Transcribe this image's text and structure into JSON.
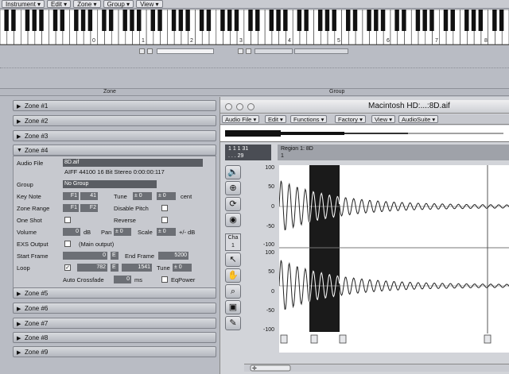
{
  "menubar": {
    "items": [
      "Instrument",
      "Edit",
      "Zone",
      "Group",
      "View"
    ]
  },
  "keyboard": {
    "octave_labels": [
      "0",
      "1",
      "2",
      "3",
      "4",
      "5",
      "6",
      "7",
      "8"
    ]
  },
  "dividers": {
    "zone_label": "Zone",
    "group_label": "Group"
  },
  "zones_top": [
    "Zone #1",
    "Zone #2",
    "Zone #3"
  ],
  "zone4": {
    "title": "Zone #4",
    "audio_file_label": "Audio File",
    "audio_file_name": "8D.aif",
    "file_info": "AIFF  44100  16 Bit  Stereo  0:00:00:117",
    "group_label": "Group",
    "group_value": "No Group",
    "key_note_label": "Key Note",
    "key_note": "F1",
    "key_note_num": "41",
    "tune_label": "Tune",
    "tune_a": "± 0",
    "tune_b": "± 0",
    "tune_unit": "cent",
    "zone_range_label": "Zone Range",
    "range_lo": "F1",
    "range_hi": "F2",
    "disable_pitch_label": "Disable Pitch",
    "one_shot_label": "One Shot",
    "reverse_label": "Reverse",
    "volume_label": "Volume",
    "volume_value": "0",
    "db_label": "dB",
    "pan_label": "Pan",
    "pan_value": "± 0",
    "scale_label": "Scale",
    "scale_value": "± 0",
    "scale_unit": "+/- dB",
    "exs_output_label": "EXS Output",
    "exs_output_value": "(Main output)",
    "start_frame_label": "Start Frame",
    "start_frame": "0",
    "e_label": "E",
    "end_frame_label": "End Frame",
    "end_frame": "5200",
    "loop_label": "Loop",
    "loop_start": "782",
    "loop_end": "1541",
    "loop_tune_label": "Tune",
    "loop_tune": "± 0",
    "auto_crossfade_label": "Auto Crossfade",
    "crossfade_value": "0",
    "ms_label": "ms",
    "eqpower_label": "EqPower"
  },
  "zones_bottom": [
    "Zone #5",
    "Zone #6",
    "Zone #7",
    "Zone #8",
    "Zone #9"
  ],
  "editor": {
    "title": "Macintosh HD:...:8D.aif",
    "menus": [
      "Audio File",
      "Edit",
      "Functions",
      "Factory",
      "View",
      "AudioSuite"
    ],
    "position_line1": "1  1  1  31",
    "position_line2": ".  .  .  29",
    "region_label": "Region 1: 8D",
    "region_num": "1",
    "cha_label": "Cha",
    "cha_value": "1",
    "y_ticks_top": [
      "100",
      "50",
      "0",
      "-50",
      "-100"
    ],
    "y_ticks_bottom": [
      "100",
      "50",
      "0",
      "-50",
      "-100"
    ]
  }
}
